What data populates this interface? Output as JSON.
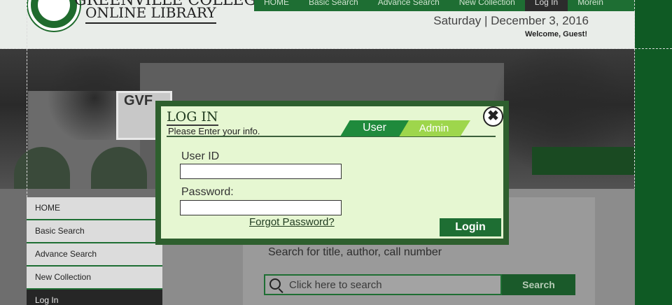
{
  "header": {
    "site_title": "GREENVILLE COLLEGE",
    "site_subtitle": "ONLINE LIBRARY",
    "date": "Saturday | December 3, 2016",
    "welcome": "Welcome, Guest!"
  },
  "topnav": {
    "items": [
      "HOME",
      "Basic Search",
      "Advance Search",
      "New Collection",
      "Log In",
      "Morein"
    ]
  },
  "banner": {
    "sign": "GVF"
  },
  "sidebar": {
    "items": [
      "HOME",
      "Basic Search",
      "Advance Search",
      "New Collection",
      "Log In"
    ]
  },
  "main": {
    "search_hint": "Search for title, author, call number",
    "search_placeholder": "Click here to search",
    "search_button": "Search"
  },
  "login_modal": {
    "title": "LOG IN",
    "subtitle": "Please Enter your info.",
    "tab_user": "User",
    "tab_admin": "Admin",
    "close_symbol": "✖",
    "userid_label": "User ID",
    "userid_value": "",
    "password_label": "Password:",
    "password_value": "",
    "forgot_password": "Forgot Password?",
    "login_button": "Login"
  },
  "colors": {
    "brand_green": "#1e6e33",
    "modal_bg": "#e6f7d2",
    "tab_user": "#1f8a3c",
    "tab_admin": "#9ed64c"
  }
}
